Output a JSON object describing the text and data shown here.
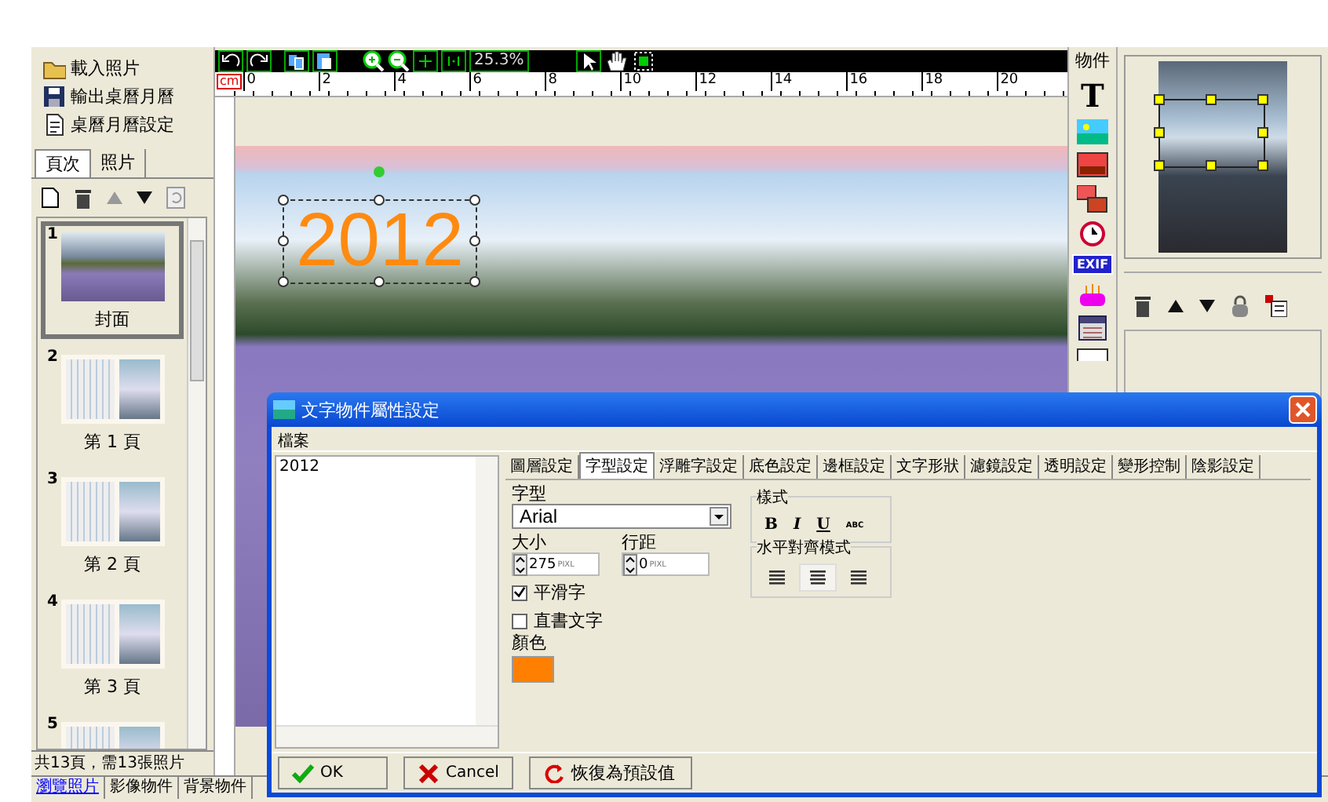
{
  "left_panel": {
    "actions": [
      {
        "label": "載入照片",
        "kind": "open"
      },
      {
        "label": "輸出桌曆月曆",
        "kind": "save"
      },
      {
        "label": "桌曆月曆設定",
        "kind": "settings"
      }
    ],
    "tabs": [
      {
        "label": "頁次",
        "selected": true
      },
      {
        "label": "照片",
        "selected": false
      }
    ],
    "pages": [
      {
        "number": "1",
        "label": "封面",
        "kind": "cover",
        "selected": true
      },
      {
        "number": "2",
        "label": "第 1 頁",
        "kind": "month",
        "selected": false
      },
      {
        "number": "3",
        "label": "第 2 頁",
        "kind": "month",
        "selected": false
      },
      {
        "number": "4",
        "label": "第 3 頁",
        "kind": "month",
        "selected": false
      },
      {
        "number": "5",
        "kind": "month",
        "selected": false
      }
    ],
    "status": "共13頁，需13張照片"
  },
  "toolbar": {
    "zoom": "25.3%"
  },
  "ruler": {
    "unit": "cm",
    "ticks": [
      "0",
      "2",
      "4",
      "6",
      "8",
      "10",
      "12",
      "14",
      "16",
      "18",
      "20"
    ]
  },
  "canvas": {
    "text_object": "2012"
  },
  "objects_panel": {
    "title": "物件",
    "text_tool_label": "T",
    "exif_label": "EXIF"
  },
  "bottom_tabs": [
    {
      "label": "瀏覽照片",
      "selected": true
    },
    {
      "label": "影像物件",
      "selected": false
    },
    {
      "label": "背景物件",
      "selected": false
    }
  ],
  "dialog": {
    "title": "文字物件屬性設定",
    "menu": [
      "檔案"
    ],
    "text_list": [
      "2012"
    ],
    "tabs": [
      {
        "label": "圖層設定",
        "selected": false
      },
      {
        "label": "字型設定",
        "selected": true
      },
      {
        "label": "浮雕字設定",
        "selected": false
      },
      {
        "label": "底色設定",
        "selected": false
      },
      {
        "label": "邊框設定",
        "selected": false
      },
      {
        "label": "文字形狀",
        "selected": false
      },
      {
        "label": "濾鏡設定",
        "selected": false
      },
      {
        "label": "透明設定",
        "selected": false
      },
      {
        "label": "變形控制",
        "selected": false
      },
      {
        "label": "陰影設定",
        "selected": false
      }
    ],
    "font": {
      "label": "字型",
      "value": "Arial"
    },
    "size": {
      "label": "大小",
      "value": "275",
      "unit": "PIXL"
    },
    "spacing": {
      "label": "行距",
      "value": "0",
      "unit": "PIXL"
    },
    "options": [
      {
        "label": "平滑字",
        "checked": true
      },
      {
        "label": "直書文字",
        "checked": false
      }
    ],
    "color": {
      "label": "顏色",
      "color": "#ff8000"
    },
    "style": {
      "title": "樣式",
      "buttons": [
        "B",
        "I",
        "U",
        "ABC"
      ]
    },
    "align": {
      "title": "水平對齊模式",
      "options": [
        {
          "kind": "left",
          "selected": false
        },
        {
          "kind": "center",
          "selected": true
        },
        {
          "kind": "right",
          "selected": false
        }
      ]
    },
    "buttons": [
      {
        "label": "OK",
        "kind": "ok"
      },
      {
        "label": "Cancel",
        "kind": "cancel"
      },
      {
        "label": "恢復為預設值",
        "kind": "reset"
      }
    ]
  }
}
